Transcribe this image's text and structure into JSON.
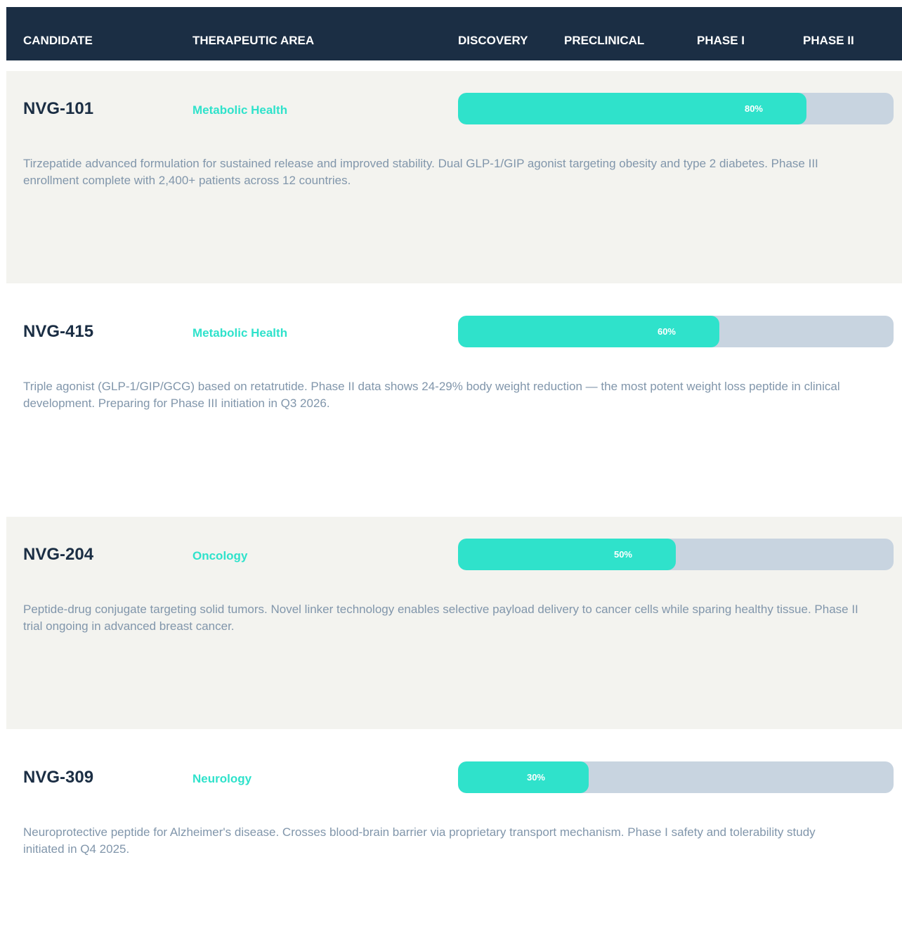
{
  "header": {
    "candidate": "CANDIDATE",
    "therapeutic_area": "THERAPEUTIC AREA",
    "discovery": "DISCOVERY",
    "preclinical": "PRECLINICAL",
    "phase1": "PHASE I",
    "phase2": "PHASE II"
  },
  "colors": {
    "header_bg": "#1b2e44",
    "accent": "#2fe2cb",
    "track": "#c8d4e0",
    "row_shade": "#f3f3ef",
    "description": "#8196ab"
  },
  "candidates": [
    {
      "name": "NVG-101",
      "area": "Metabolic Health",
      "progress": 80,
      "progress_label": "80%",
      "description": "Tirzepatide advanced formulation for sustained release and improved stability. Dual GLP-1/GIP agonist targeting obesity and type 2 diabetes. Phase III enrollment complete with 2,400+ patients across 12 countries."
    },
    {
      "name": "NVG-415",
      "area": "Metabolic Health",
      "progress": 60,
      "progress_label": "60%",
      "description": "Triple agonist (GLP-1/GIP/GCG) based on retatrutide. Phase II data shows 24-29% body weight reduction — the most potent weight loss peptide in clinical development. Preparing for Phase III initiation in Q3 2026."
    },
    {
      "name": "NVG-204",
      "area": "Oncology",
      "progress": 50,
      "progress_label": "50%",
      "description": "Peptide-drug conjugate targeting solid tumors. Novel linker technology enables selective payload delivery to cancer cells while sparing healthy tissue. Phase II trial ongoing in advanced breast cancer."
    },
    {
      "name": "NVG-309",
      "area": "Neurology",
      "progress": 30,
      "progress_label": "30%",
      "description": "Neuroprotective peptide for Alzheimer's disease. Crosses blood-brain barrier via proprietary transport mechanism. Phase I safety and tolerability study initiated in Q4 2025."
    }
  ]
}
